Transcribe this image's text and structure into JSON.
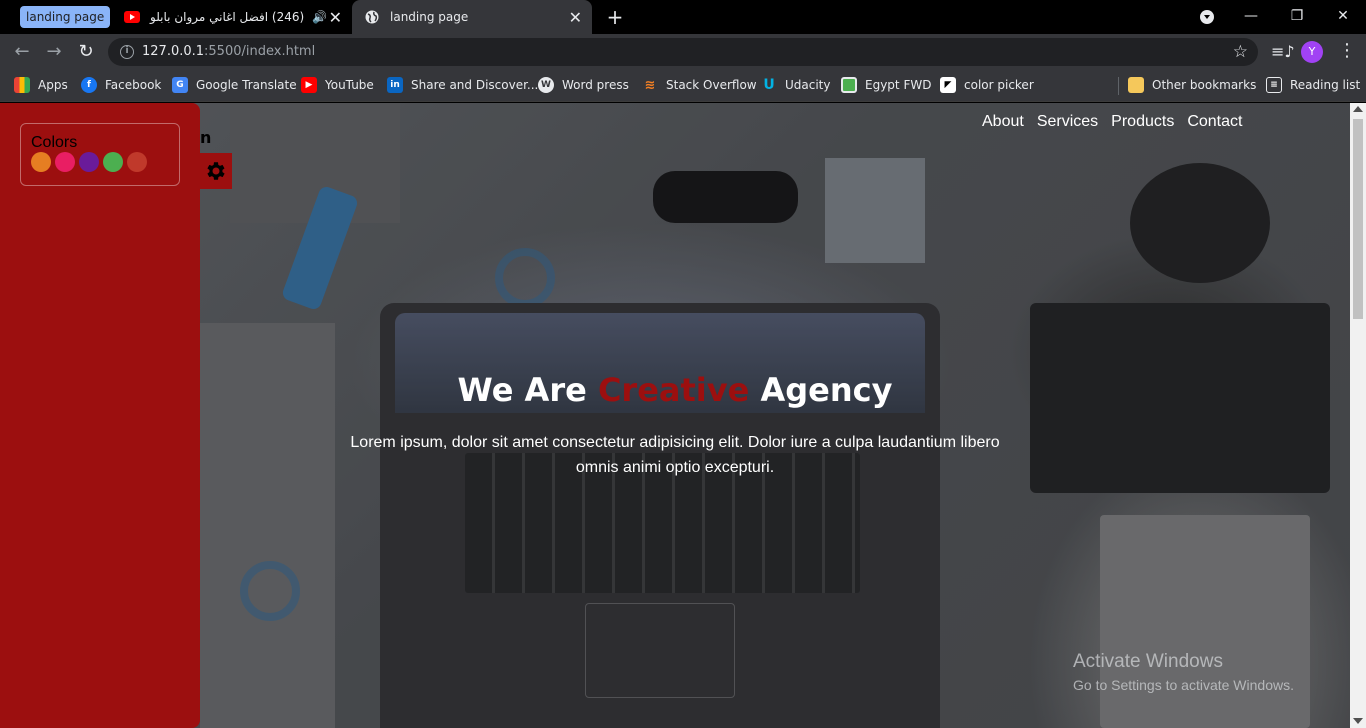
{
  "browser": {
    "tab_group_label": "landing page",
    "tabs": [
      {
        "title": "(246) افضل اغاني مروان بابلو",
        "favicon": "youtube-icon",
        "audio": true
      },
      {
        "title": "landing page",
        "favicon": "globe-icon",
        "active": true
      }
    ],
    "address": {
      "host": "127.0.0.1",
      "path": ":5500/index.html"
    },
    "profile_initial": "Y",
    "bookmarks": [
      {
        "label": "Apps",
        "icon": "apps-icon"
      },
      {
        "label": "Facebook",
        "icon": "facebook-icon"
      },
      {
        "label": "Google Translate",
        "icon": "translate-icon"
      },
      {
        "label": "YouTube",
        "icon": "youtube-icon"
      },
      {
        "label": "Share and Discover...",
        "icon": "linkedin-icon"
      },
      {
        "label": "Word press",
        "icon": "wordpress-icon"
      },
      {
        "label": "Stack Overflow",
        "icon": "stackoverflow-icon"
      },
      {
        "label": "Udacity",
        "icon": "udacity-icon"
      },
      {
        "label": "Egypt FWD",
        "icon": "fwd-icon"
      },
      {
        "label": "color picker",
        "icon": "colorpicker-icon"
      }
    ],
    "other_bookmarks": "Other bookmarks",
    "reading_list": "Reading list"
  },
  "page": {
    "logo_fragment": "n",
    "nav": [
      "About",
      "Services",
      "Products",
      "Contact"
    ],
    "hero": {
      "title_before": "We Are ",
      "title_accent": "Creative",
      "title_after": " Agency",
      "text": "Lorem ipsum, dolor sit amet consectetur adipisicing elit. Dolor iure a culpa laudantium libero omnis animi optio excepturi."
    },
    "settings": {
      "colors_title": "Colors",
      "swatches": [
        "#e67e22",
        "#e91e63",
        "#6a1b9a",
        "#4caf50",
        "#c0392b"
      ],
      "panel_color": "#9c0f0f"
    }
  },
  "os": {
    "watermark_title": "Activate Windows",
    "watermark_sub": "Go to Settings to activate Windows."
  }
}
